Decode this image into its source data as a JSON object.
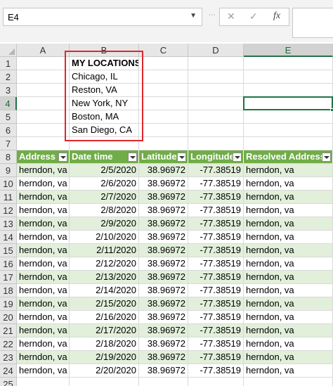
{
  "formula_bar": {
    "name_box": "E4",
    "cancel_glyph": "✕",
    "enter_glyph": "✓",
    "fx_glyph": "fx",
    "formula": ""
  },
  "columns": [
    "A",
    "B",
    "C",
    "D",
    "E"
  ],
  "selected_column": "E",
  "selected_row": 4,
  "active_cell": "E4",
  "locations": {
    "title": "MY LOCATIONS",
    "items": [
      "Chicago, IL",
      "Reston, VA",
      "New York, NY",
      "Boston, MA",
      "San Diego, CA"
    ]
  },
  "table": {
    "headers": [
      "Address",
      "Date time",
      "Latitude",
      "Longitude",
      "Resolved Address"
    ],
    "rows": [
      [
        "herndon, va",
        "2/5/2020",
        "38.96972",
        "-77.38519",
        "herndon, va"
      ],
      [
        "herndon, va",
        "2/6/2020",
        "38.96972",
        "-77.38519",
        "herndon, va"
      ],
      [
        "herndon, va",
        "2/7/2020",
        "38.96972",
        "-77.38519",
        "herndon, va"
      ],
      [
        "herndon, va",
        "2/8/2020",
        "38.96972",
        "-77.38519",
        "herndon, va"
      ],
      [
        "herndon, va",
        "2/9/2020",
        "38.96972",
        "-77.38519",
        "herndon, va"
      ],
      [
        "herndon, va",
        "2/10/2020",
        "38.96972",
        "-77.38519",
        "herndon, va"
      ],
      [
        "herndon, va",
        "2/11/2020",
        "38.96972",
        "-77.38519",
        "herndon, va"
      ],
      [
        "herndon, va",
        "2/12/2020",
        "38.96972",
        "-77.38519",
        "herndon, va"
      ],
      [
        "herndon, va",
        "2/13/2020",
        "38.96972",
        "-77.38519",
        "herndon, va"
      ],
      [
        "herndon, va",
        "2/14/2020",
        "38.96972",
        "-77.38519",
        "herndon, va"
      ],
      [
        "herndon, va",
        "2/15/2020",
        "38.96972",
        "-77.38519",
        "herndon, va"
      ],
      [
        "herndon, va",
        "2/16/2020",
        "38.96972",
        "-77.38519",
        "herndon, va"
      ],
      [
        "herndon, va",
        "2/17/2020",
        "38.96972",
        "-77.38519",
        "herndon, va"
      ],
      [
        "herndon, va",
        "2/18/2020",
        "38.96972",
        "-77.38519",
        "herndon, va"
      ],
      [
        "herndon, va",
        "2/19/2020",
        "38.96972",
        "-77.38519",
        "herndon, va"
      ],
      [
        "herndon, va",
        "2/20/2020",
        "38.96972",
        "-77.38519",
        "herndon, va"
      ]
    ]
  },
  "colors": {
    "table_header": "#70ad47",
    "band": "#e2efda",
    "highlight_border": "#e0262c",
    "selection": "#217346"
  }
}
